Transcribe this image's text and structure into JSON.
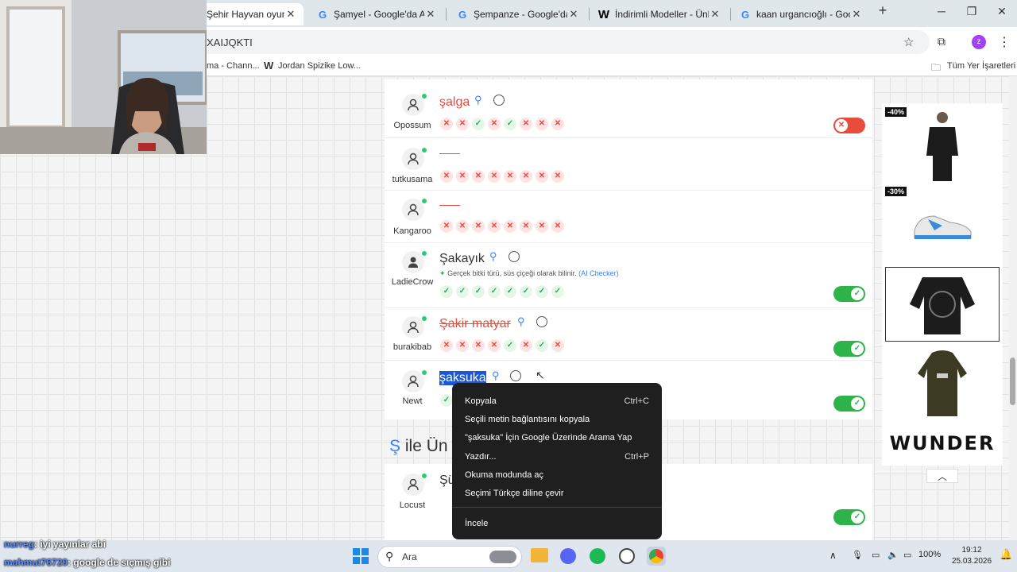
{
  "browser": {
    "tabs": [
      {
        "title": "Şehir Hayvan oyununa",
        "favicon": "game-icon",
        "active": true
      },
      {
        "title": "Şamyel - Google'da Ara",
        "favicon": "google-icon"
      },
      {
        "title": "Şempanze - Google'da Ara",
        "favicon": "google-icon"
      },
      {
        "title": "İndirimli Modeller - Ünlü M",
        "favicon": "W"
      },
      {
        "title": "kaan urgancıoğlı - Google",
        "favicon": "google-icon"
      }
    ],
    "new_tab": "+",
    "url": "XAIJQKTI",
    "bookmarks": [
      "ma - Chann...",
      "Jordan Spizike Low..."
    ],
    "bookmarks_folder": "Tüm Yer İşaretleri",
    "profile_initial": "z"
  },
  "answers": [
    {
      "user": "Opossum",
      "word": "şalga",
      "style": "red",
      "votes": [
        "no",
        "no",
        "ok",
        "no",
        "ok",
        "no",
        "no",
        "no"
      ],
      "toggle": "off"
    },
    {
      "user": "tutkusama",
      "word": "",
      "style": "dash",
      "votes": [
        "no",
        "no",
        "no",
        "no",
        "no",
        "no",
        "no",
        "no"
      ],
      "toggle": null
    },
    {
      "user": "Kangaroo",
      "word": "",
      "style": "dash",
      "votes": [
        "no",
        "no",
        "no",
        "no",
        "no",
        "no",
        "no",
        "no"
      ],
      "toggle": null
    },
    {
      "user": "LadieCrow",
      "word": "Şakayık",
      "style": "normal",
      "hint": "Gerçek bitki türü, süs çiçeği olarak bilinir.",
      "hint_source": "(AI Checker)",
      "votes": [
        "ok",
        "ok",
        "ok",
        "ok",
        "ok",
        "ok",
        "ok",
        "ok"
      ],
      "toggle": "on"
    },
    {
      "user": "burakibab",
      "word": "Şakir matyar",
      "style": "red-strike",
      "votes": [
        "no",
        "no",
        "no",
        "no",
        "ok",
        "no",
        "ok",
        "no"
      ],
      "toggle": "on"
    },
    {
      "user": "Newt",
      "word": "şaksuka",
      "style": "selected",
      "votes": [
        "ok"
      ],
      "toggle": "on"
    }
  ],
  "section": {
    "letter": "Ş",
    "title_rest": "ile Ün"
  },
  "next_row": {
    "user": "Locust",
    "word": "Şü"
  },
  "context_menu": [
    {
      "label": "Kopyala",
      "shortcut": "Ctrl+C"
    },
    {
      "label": "Seçili metin bağlantısını kopyala",
      "shortcut": ""
    },
    {
      "label": "\"şaksuka\" İçin Google Üzerinde Arama Yap",
      "shortcut": ""
    },
    {
      "label": "Yazdır...",
      "shortcut": "Ctrl+P"
    },
    {
      "label": "Okuma modunda aç",
      "shortcut": ""
    },
    {
      "label": "Seçimi Türkçe diline çevir",
      "shortcut": ""
    },
    {
      "label": "İncele",
      "shortcut": ""
    }
  ],
  "ads": {
    "discounts": [
      "-40%",
      "-30%"
    ],
    "brand": "WUNDER"
  },
  "chat": [
    {
      "name": "nurreg",
      "msg": ": iyi yayınlar abi"
    },
    {
      "name": "mahmut76720",
      "msg": ": google de sıçmış gibi"
    }
  ],
  "taskbar": {
    "search": "Ara",
    "battery": "100%",
    "time": "19:12",
    "date": "25.03.2026"
  },
  "colors": {
    "accent": "#3b82f6",
    "ok": "#2db34a",
    "error": "#e74c3c",
    "selection": "#1a56d6"
  }
}
